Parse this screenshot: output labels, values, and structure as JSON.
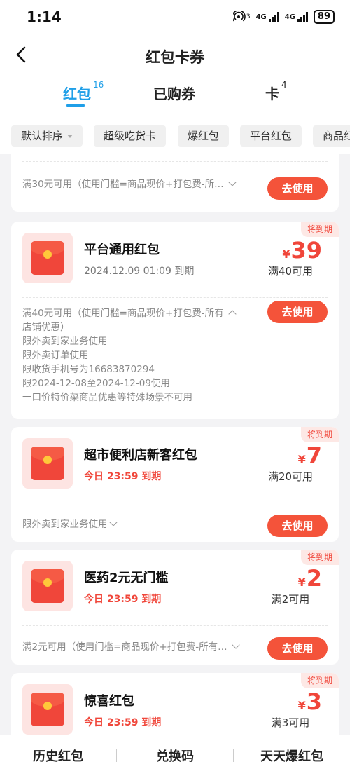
{
  "status_bar": {
    "time": "1:14",
    "network_1": "4G",
    "network_2": "4G",
    "hotspot_sup": "3",
    "battery": "89"
  },
  "header": {
    "title": "红包卡券",
    "back_icon": "chevron-left-icon"
  },
  "tabs": [
    {
      "label": "红包",
      "count": "16",
      "active": true
    },
    {
      "label": "已购券",
      "count": "",
      "active": false
    },
    {
      "label": "卡",
      "count": "4",
      "active": false
    }
  ],
  "filters": [
    "默认排序",
    "超级吃货卡",
    "爆红包",
    "平台红包",
    "商品红"
  ],
  "partial_card": {
    "rule": "满30元可用（使用门槛=商品现价+打包费-所…",
    "button": "去使用"
  },
  "cards": [
    {
      "badge": "将到期",
      "name": "平台通用红包",
      "expire": "2024.12.09 01:09 到期",
      "currency": "¥",
      "amount": "39",
      "threshold": "满40可用",
      "rules": [
        "满40元可用（使用门槛=商品现价+打包费-所有",
        "店铺优惠）",
        "限外卖到家业务使用",
        "限外卖订单使用",
        "限收货手机号为16683870294",
        "限2024-12-08至2024-12-09使用",
        "一口价特价菜商品优惠等特殊场景不可用"
      ],
      "button": "去使用"
    },
    {
      "badge": "将到期",
      "name": "超市便利店新客红包",
      "expire": "今日 23:59 到期",
      "currency": "¥",
      "amount": "7",
      "threshold": "满20可用",
      "rule": "限外卖到家业务使用",
      "button": "去使用"
    },
    {
      "badge": "将到期",
      "name": "医药2元无门槛",
      "expire": "今日 23:59 到期",
      "currency": "¥",
      "amount": "2",
      "threshold": "满2可用",
      "rule": "满2元可用（使用门槛=商品现价+打包费-所有…",
      "button": "去使用"
    },
    {
      "badge": "将到期",
      "name": "惊喜红包",
      "expire": "今日 23:59 到期",
      "currency": "¥",
      "amount": "3",
      "threshold": "满3可用"
    }
  ],
  "bottom_bar": [
    "历史红包",
    "兑换码",
    "天天爆红包"
  ]
}
